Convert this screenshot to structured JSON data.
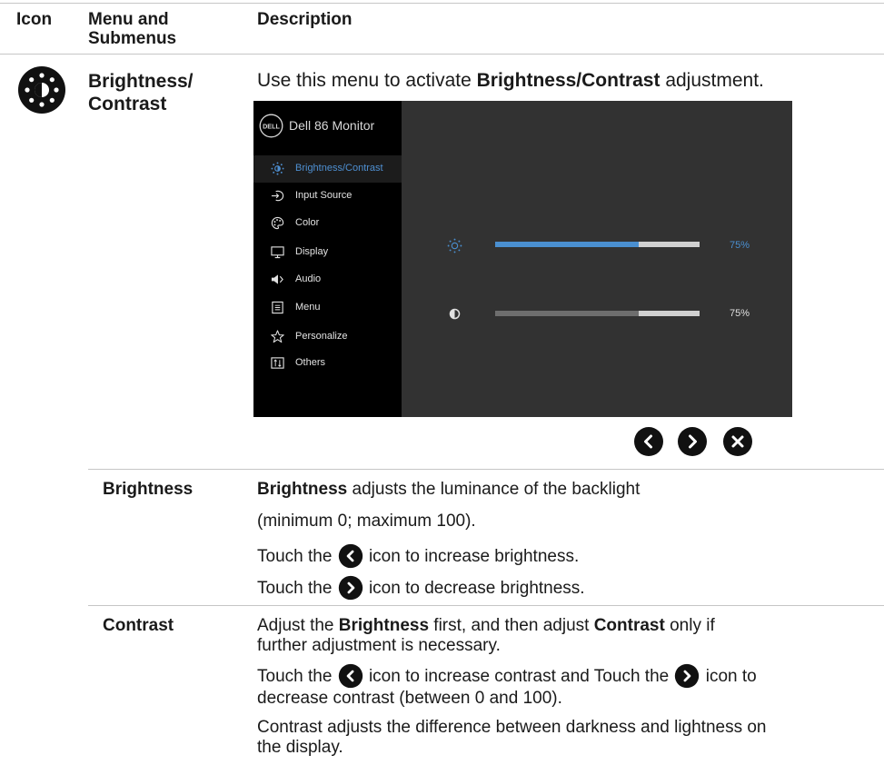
{
  "table": {
    "headers": {
      "icon": "Icon",
      "menu_line1": "Menu and",
      "menu_line2": "Submenus",
      "description": "Description"
    },
    "row": {
      "menu_line1": "Brightness/",
      "menu_line2": "Contrast",
      "intro_prefix": "Use this menu to activate ",
      "intro_bold": "Brightness/Contrast",
      "intro_suffix": " adjustment.",
      "icon": "brightness-icon"
    }
  },
  "osd": {
    "logo_text": "DELL",
    "model": "Dell 86 Monitor",
    "menu_items": [
      {
        "label": "Brightness/Contrast",
        "icon": "brightness-icon",
        "active": true
      },
      {
        "label": "Input Source",
        "icon": "input-source-icon"
      },
      {
        "label": "Color",
        "icon": "color-palette-icon"
      },
      {
        "label": "Display",
        "icon": "display-monitor-icon"
      },
      {
        "label": "Audio",
        "icon": "speaker-icon"
      },
      {
        "label": "Menu",
        "icon": "menu-list-icon"
      },
      {
        "label": "Personalize",
        "icon": "star-icon"
      },
      {
        "label": "Others",
        "icon": "others-icon"
      }
    ],
    "brightness": {
      "value_label": "75%",
      "level": 0.7,
      "fill_color": "#4a8fd0",
      "label_color": "#4a8fd0"
    },
    "contrast": {
      "value_label": "75%",
      "level": 0.7,
      "fill_color": "#6e6e6e",
      "label_color": "#e0e0e0"
    },
    "nav_buttons": [
      "chevron-left-icon",
      "chevron-right-icon",
      "close-icon"
    ]
  },
  "submenus": {
    "brightness": {
      "name": "Brightness",
      "line1_bold": "Brightness",
      "line1_rest": " adjusts the luminance of the backlight",
      "line2": "(minimum 0; maximum 100).",
      "line3_pre": "Touch the ",
      "line3_post": " icon to increase brightness.",
      "line4_pre": "Touch the ",
      "line4_post": " icon to decrease brightness."
    },
    "contrast": {
      "name": "Contrast",
      "p1_a": "Adjust the ",
      "p1_b": "Brightness",
      "p1_c": " first, and then adjust ",
      "p1_d": "Contrast",
      "p1_e": " only if",
      "p1_line2": "further adjustment is necessary.",
      "p2_a": "Touch the ",
      "p2_b": " icon to increase contrast and Touch the ",
      "p2_c": " icon to",
      "p2_line2": "decrease contrast (between 0 and 100).",
      "p3_line1": "Contrast adjusts the difference between darkness and lightness on",
      "p3_line2": "the display."
    }
  }
}
